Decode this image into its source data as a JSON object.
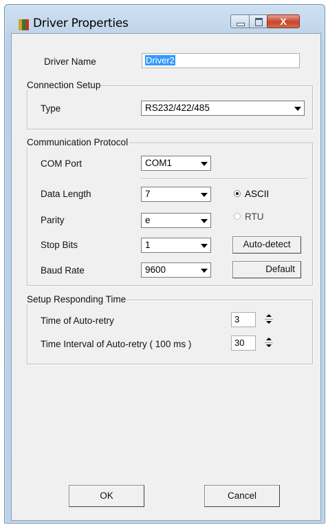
{
  "window": {
    "title": "Driver Properties",
    "close_glyph": "X"
  },
  "driver_name": {
    "label": "Driver Name",
    "value": "Driver2"
  },
  "connection_setup": {
    "title": "Connection Setup",
    "type_label": "Type",
    "type_value": "RS232/422/485"
  },
  "communication_protocol": {
    "title": "Communication Protocol",
    "com_port_label": "COM Port",
    "com_port_value": "COM1",
    "data_length_label": "Data Length",
    "data_length_value": "7",
    "parity_label": "Parity",
    "parity_value": "e",
    "stop_bits_label": "Stop Bits",
    "stop_bits_value": "1",
    "baud_rate_label": "Baud Rate",
    "baud_rate_value": "9600",
    "mode_ascii": "ASCII",
    "mode_rtu": "RTU",
    "selected_mode": "ASCII",
    "auto_detect_button": "Auto-detect",
    "default_button": "Default"
  },
  "responding_time": {
    "title": "Setup Responding Time",
    "auto_retry_label": "Time of Auto-retry",
    "auto_retry_value": "3",
    "interval_label": "Time Interval of Auto-retry ( 100 ms )",
    "interval_value": "30"
  },
  "footer": {
    "ok_button": "OK",
    "cancel_button": "Cancel"
  },
  "colors": {
    "titlebar": "#bcd3ea",
    "dialog_face": "#f0f0f0",
    "selection": "#3399ff",
    "close_button": "#c8452e"
  }
}
